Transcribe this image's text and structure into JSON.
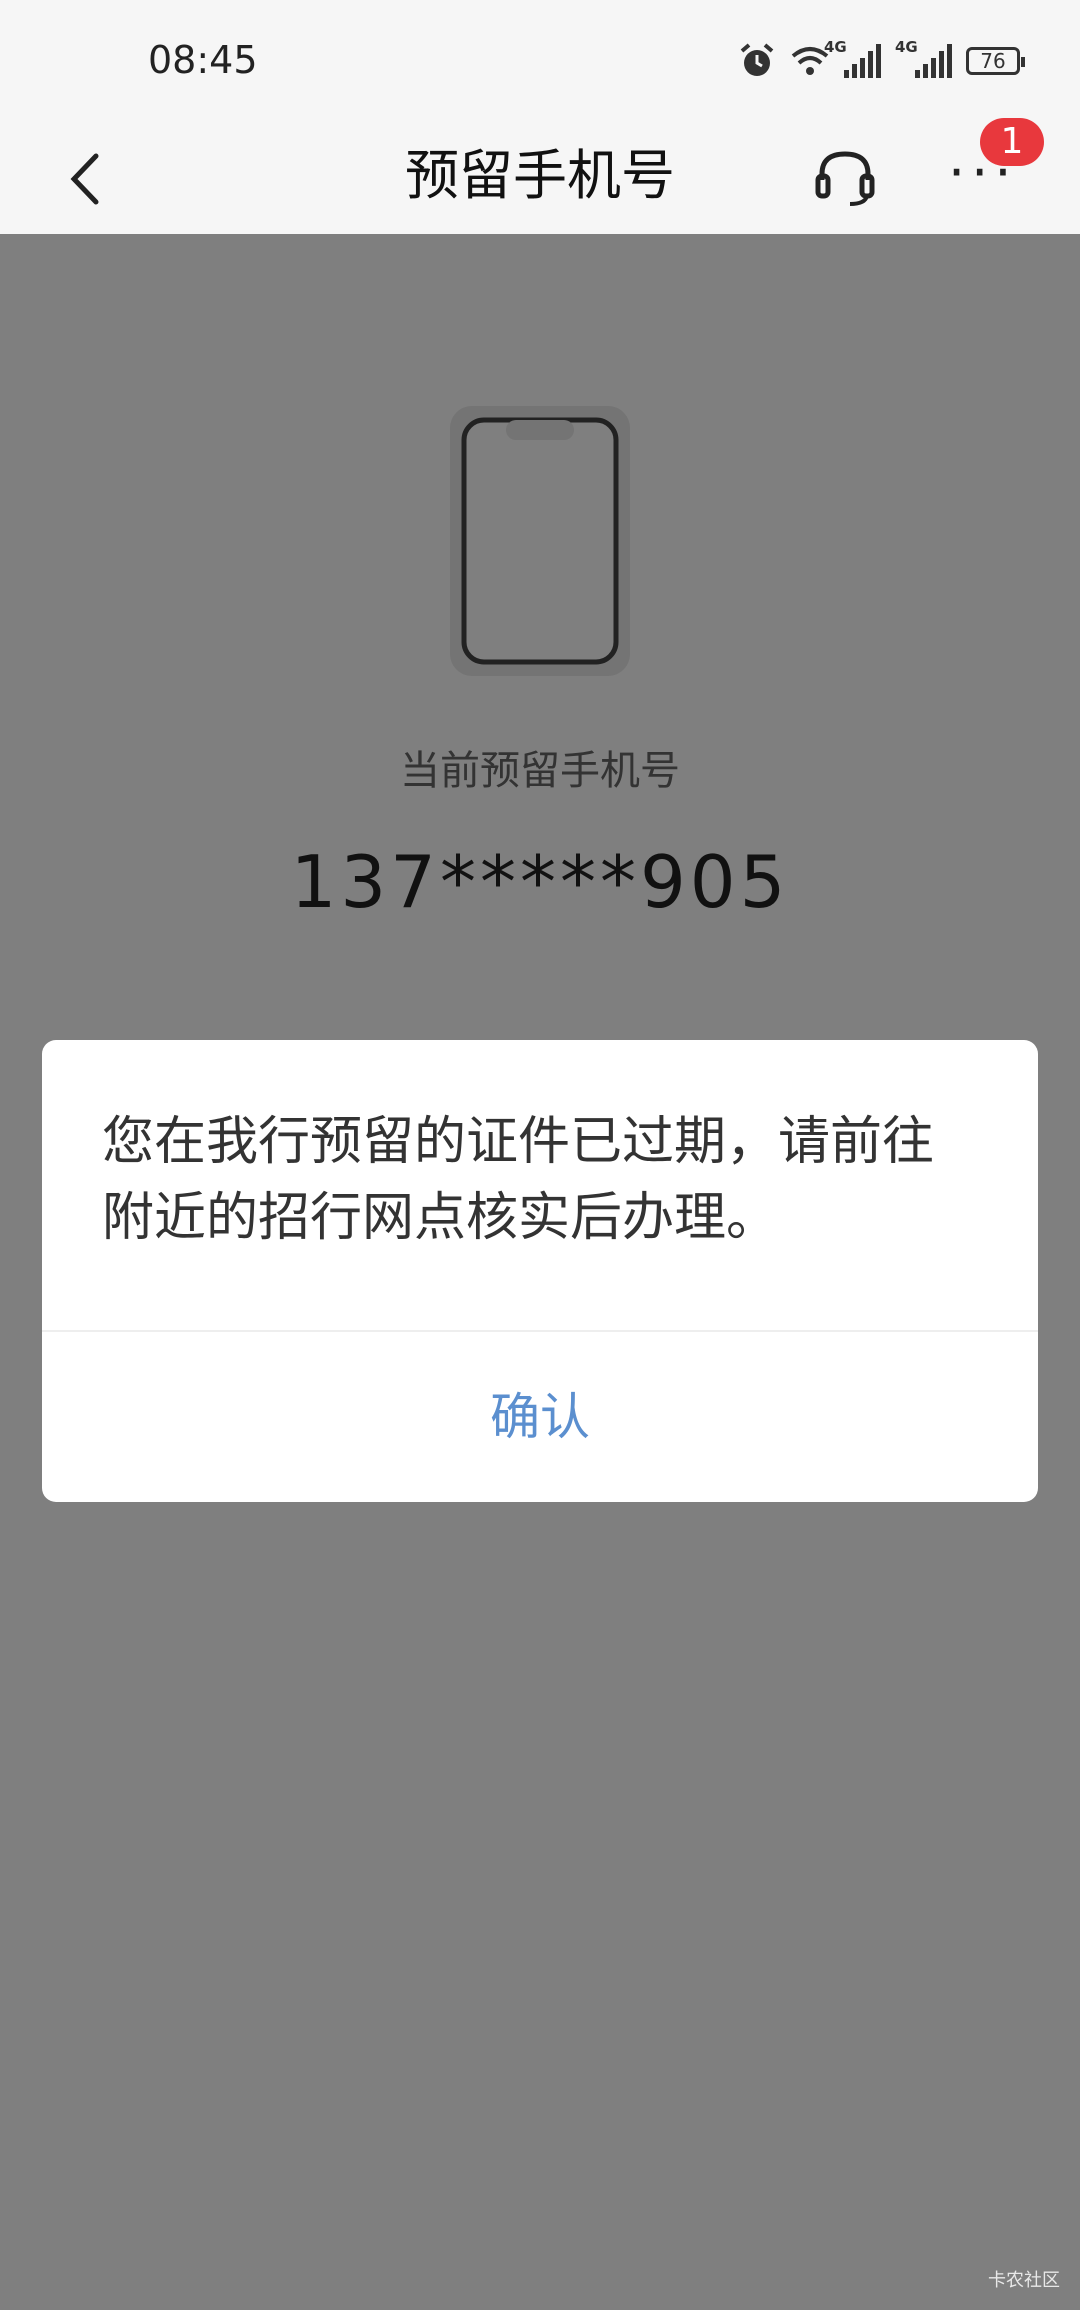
{
  "status_bar": {
    "time": "08:45",
    "network_left": "4G",
    "network_right": "4G",
    "battery": "76",
    "icons": [
      "alarm-icon",
      "wifi-icon",
      "signal-icon",
      "signal-icon",
      "battery-icon"
    ]
  },
  "nav": {
    "title": "预留手机号",
    "badge_count": "1",
    "icons": [
      "back-icon",
      "headset-icon",
      "more-icon"
    ]
  },
  "main": {
    "current_label": "当前预留手机号",
    "phone_number": "137*****905"
  },
  "dialog": {
    "message": "您在我行预留的证件已过期，请前往附近的招行网点核实后办理。",
    "confirm_label": "确认"
  },
  "watermark": "卡农社区",
  "colors": {
    "overlay": "#7f7f7f",
    "accent": "#5b8fcf",
    "badge": "#e8383d"
  }
}
